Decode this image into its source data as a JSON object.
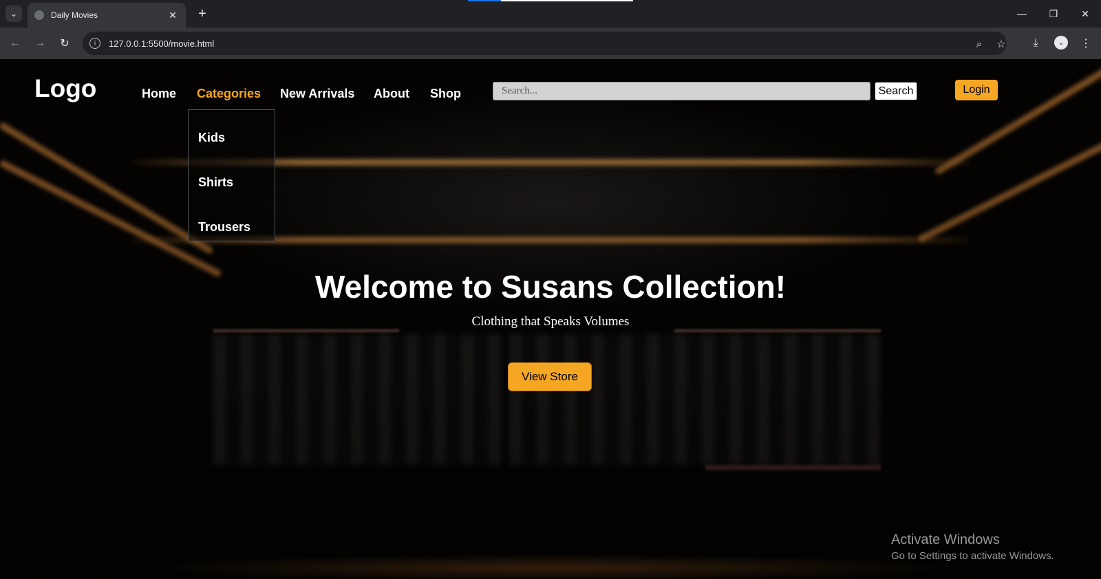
{
  "browser": {
    "tab_title": "Daily Movies",
    "url": "127.0.0.1:5500/movie.html",
    "new_tab_glyph": "+",
    "close_glyph": "✕"
  },
  "site": {
    "logo": "Logo",
    "nav": [
      "Home",
      "Categories",
      "New Arrivals",
      "About",
      "Shop"
    ],
    "active_nav": "Categories",
    "dropdown": [
      "Kids",
      "Shirts",
      "Trousers"
    ],
    "search_placeholder": "Search...",
    "search_button": "Search",
    "login_button": "Login",
    "accent_color": "#f5a623"
  },
  "hero": {
    "title": "Welcome to Susans Collection!",
    "subtitle": "Clothing that Speaks Volumes",
    "cta": "View Store"
  },
  "watermark": {
    "title": "Activate Windows",
    "subtitle": "Go to Settings to activate Windows."
  }
}
